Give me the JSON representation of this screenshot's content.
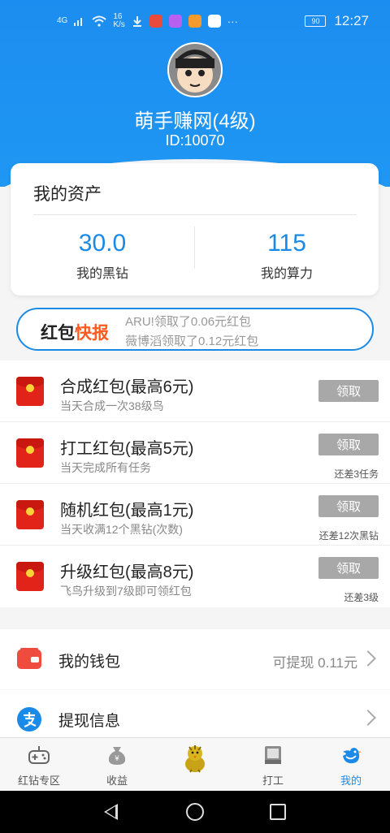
{
  "status_bar": {
    "network": "4G",
    "speed_value": "16",
    "speed_unit": "K/s",
    "battery": "90",
    "time": "12:27",
    "more": "···"
  },
  "profile": {
    "username": "萌手赚网(4级)",
    "id_text": "ID:10070"
  },
  "assets": {
    "title": "我的资产",
    "black_diamond": {
      "value": "30.0",
      "label": "我的黑钻"
    },
    "compute": {
      "value": "115",
      "label": "我的算力"
    }
  },
  "ticker": {
    "label_part1": "红包",
    "label_part2": "快报",
    "lines": [
      "ARU!领取了0.06元红包",
      "薇博滔领取了0.12元红包"
    ]
  },
  "tasks": [
    {
      "title": "合成红包(最高6元)",
      "desc": "当天合成一次38级鸟",
      "button": "领取",
      "note": ""
    },
    {
      "title": "打工红包(最高5元)",
      "desc": "当天完成所有任务",
      "button": "领取",
      "note": "还差3任务"
    },
    {
      "title": "随机红包(最高1元)",
      "desc": "当天收满12个黑钻(次数)",
      "button": "领取",
      "note": "还差12次黑钻"
    },
    {
      "title": "升级红包(最高8元)",
      "desc": "飞鸟升级到7级即可领红包",
      "button": "领取",
      "note": "还差3级"
    }
  ],
  "menu": {
    "wallet": {
      "label": "我的钱包",
      "value": "可提现 0.11元",
      "icon": "wallet-icon"
    },
    "withdraw": {
      "label": "提现信息",
      "icon": "alipay-icon"
    }
  },
  "tabs": [
    {
      "label": "红钻专区",
      "icon": "gamepad-icon"
    },
    {
      "label": "收益",
      "icon": "money-bag-icon"
    },
    {
      "label": "",
      "icon": "bird-mascot-icon"
    },
    {
      "label": "打工",
      "icon": "book-icon"
    },
    {
      "label": "我的",
      "icon": "bird-icon",
      "active": true
    }
  ],
  "colors": {
    "header_blue": "#1c8df0",
    "accent_blue": "#1a8ae8",
    "orange": "#ff5a1f",
    "red": "#e2231a",
    "button_gray": "#a8a8a8"
  }
}
